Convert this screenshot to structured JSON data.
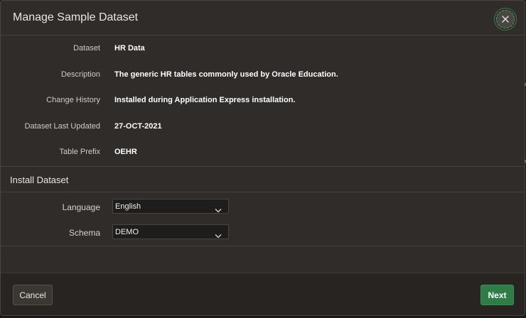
{
  "dialog": {
    "title": "Manage Sample Dataset",
    "close_icon": "close-icon"
  },
  "dataset_info": [
    {
      "label": "Dataset",
      "value": "HR Data"
    },
    {
      "label": "Description",
      "value": "The generic HR tables commonly used by Oracle Education."
    },
    {
      "label": "Change History",
      "value": "Installed during Application Express installation."
    },
    {
      "label": "Dataset Last Updated",
      "value": "27-OCT-2021"
    },
    {
      "label": "Table Prefix",
      "value": "OEHR"
    }
  ],
  "install": {
    "section_title": "Install Dataset",
    "language": {
      "label": "Language",
      "value": "English"
    },
    "schema": {
      "label": "Schema",
      "value": "DEMO"
    }
  },
  "footer": {
    "cancel_label": "Cancel",
    "next_label": "Next"
  },
  "colors": {
    "dialog_bg": "#302c29",
    "footer_bg": "#282421",
    "primary_button": "#2f7d46"
  }
}
